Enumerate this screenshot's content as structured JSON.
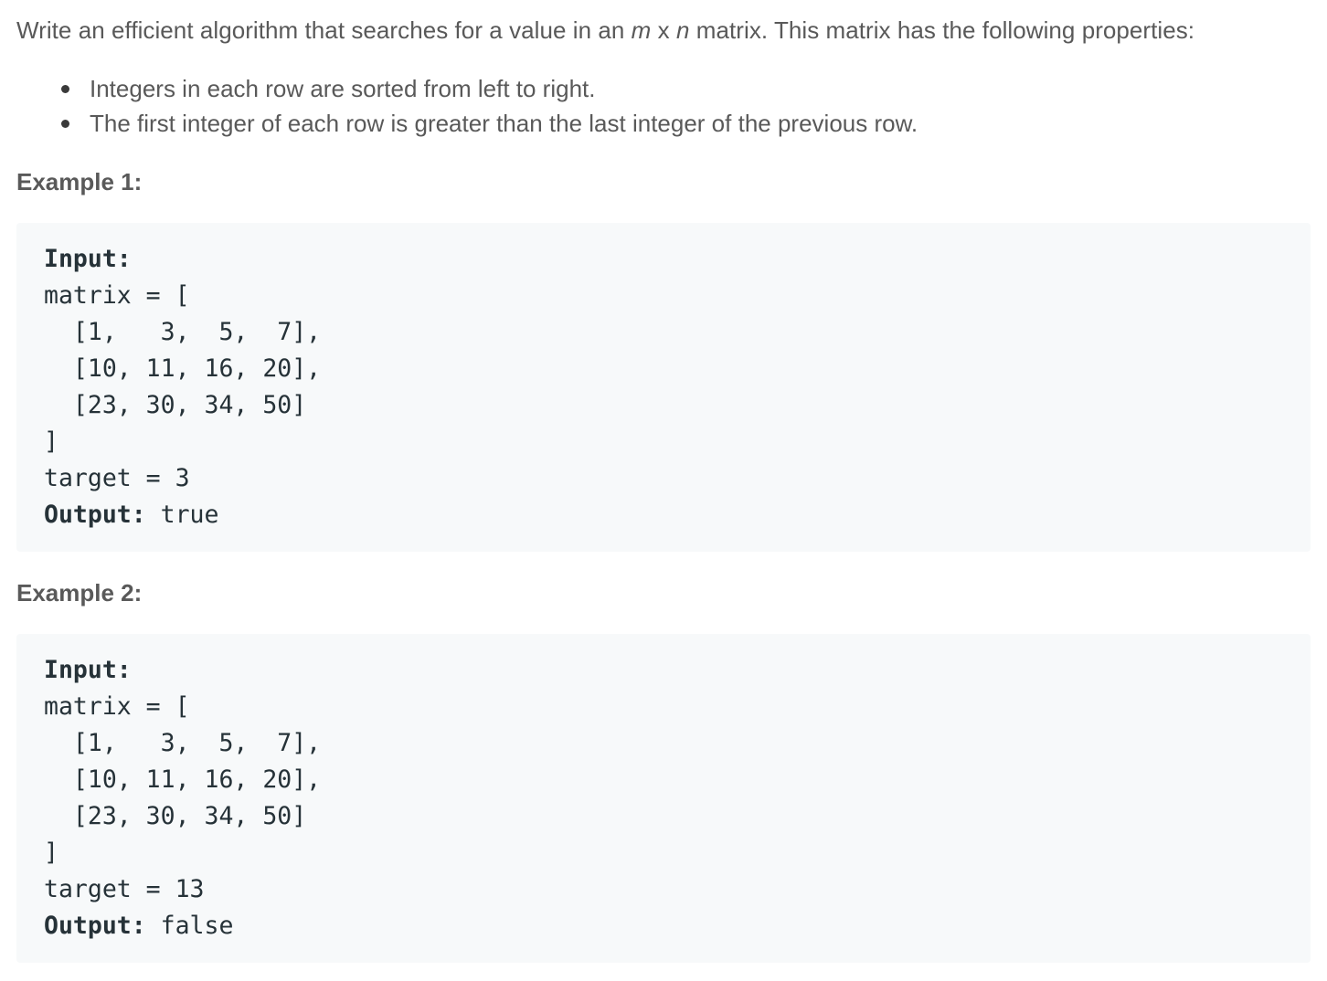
{
  "intro": {
    "before": "Write an efficient algorithm that searches for a value in an ",
    "m": "m",
    "x": " x ",
    "n": "n",
    "after": " matrix. This matrix has the following properties:"
  },
  "bullets": [
    "Integers in each row are sorted from left to right.",
    "The first integer of each row is greater than the last integer of the previous row."
  ],
  "examples": [
    {
      "heading": "Example 1:",
      "input_label": "Input:",
      "lines": [
        "matrix = [",
        "  [1,   3,  5,  7],",
        "  [10, 11, 16, 20],",
        "  [23, 30, 34, 50]",
        "]",
        "target = 3"
      ],
      "output_label": "Output:",
      "output_value": " true"
    },
    {
      "heading": "Example 2:",
      "input_label": "Input:",
      "lines": [
        "matrix = [",
        "  [1,   3,  5,  7],",
        "  [10, 11, 16, 20],",
        "  [23, 30, 34, 50]",
        "]",
        "target = 13"
      ],
      "output_label": "Output:",
      "output_value": " false"
    }
  ]
}
